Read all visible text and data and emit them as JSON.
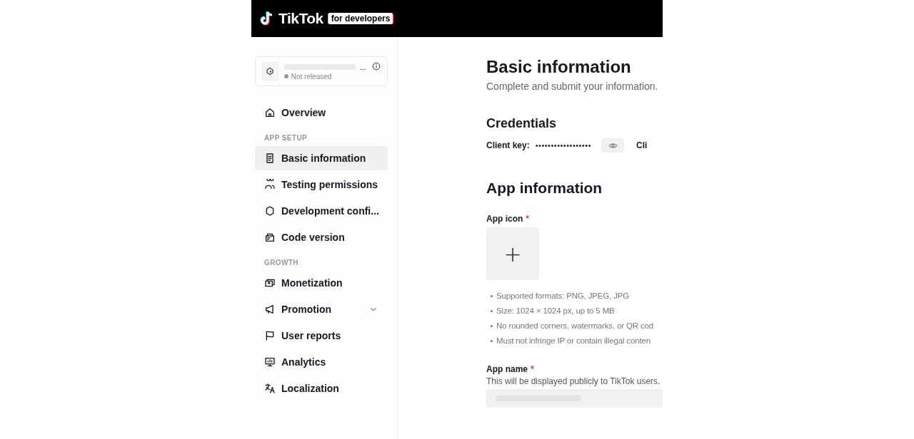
{
  "header": {
    "brand": "TikTok",
    "badge": "for developers"
  },
  "app_card": {
    "name_suffix": "...",
    "status": "Not released"
  },
  "nav": [
    {
      "kind": "item",
      "label": "Overview",
      "selected": false
    },
    {
      "kind": "section",
      "label": "APP SETUP"
    },
    {
      "kind": "item",
      "label": "Basic information",
      "selected": true
    },
    {
      "kind": "item",
      "label": "Testing permissions",
      "selected": false
    },
    {
      "kind": "item",
      "label": "Development confi...",
      "selected": false
    },
    {
      "kind": "item",
      "label": "Code version",
      "selected": false
    },
    {
      "kind": "section",
      "label": "GROWTH"
    },
    {
      "kind": "item",
      "label": "Monetization",
      "selected": false
    },
    {
      "kind": "group",
      "label": "Promotion",
      "selected": false,
      "expanded": false
    },
    {
      "kind": "item",
      "label": "User reports",
      "selected": false
    },
    {
      "kind": "item",
      "label": "Analytics",
      "selected": false
    },
    {
      "kind": "item",
      "label": "Localization",
      "selected": false
    }
  ],
  "main": {
    "title": "Basic information",
    "subtitle": "Complete and submit your information.",
    "credentials": {
      "heading": "Credentials",
      "client_key_label": "Client key:",
      "client_key_value": "••••••••••••••••••",
      "next_label": "Cli"
    },
    "app_information": {
      "heading": "App information",
      "app_icon": {
        "label": "App icon",
        "required_mark": "*",
        "upload": "+",
        "rules": [
          "Supported formats: PNG, JPEG, JPG",
          "Size: 1024 × 1024 px, up to 5 MB",
          "No rounded corners, watermarks, or QR cod",
          "Must not infringe IP or contain illegal conten"
        ]
      },
      "app_name": {
        "label": "App name",
        "required_mark": "*",
        "hint": "This will be displayed publicly to TikTok users."
      }
    }
  }
}
